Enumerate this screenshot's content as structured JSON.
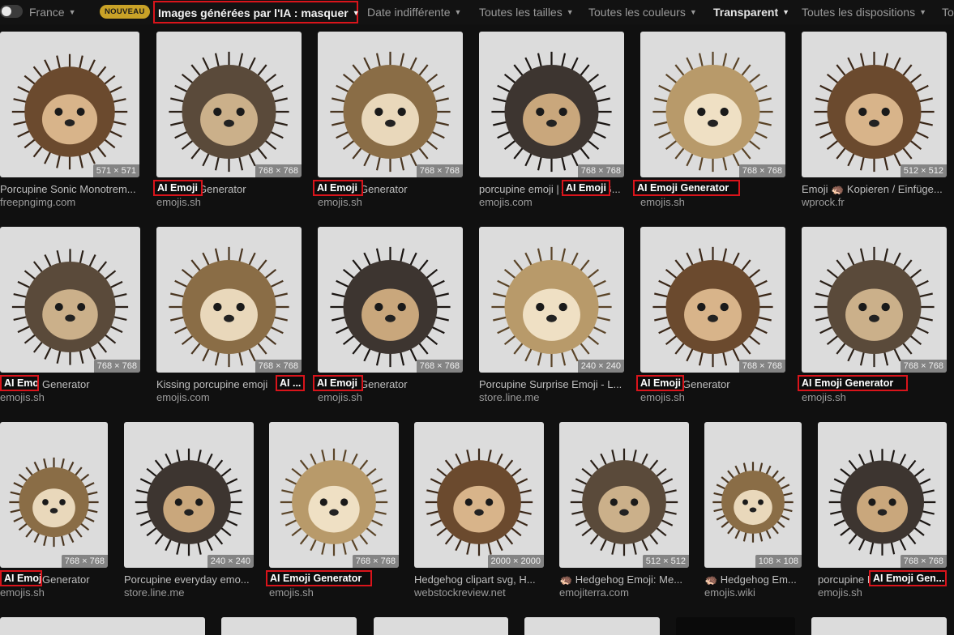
{
  "filters": {
    "region": "France",
    "new_badge": "NOUVEAU",
    "ai_images": "Images générées par l'IA : masquer",
    "date": "Date indifférente",
    "size": "Toutes les tailles",
    "color": "Toutes les couleurs",
    "type": "Transparent",
    "layout": "Toutes les dispositions",
    "overflow": "To"
  },
  "colors": {
    "highlight_border": "#d9141b",
    "new_badge": "#c9a227",
    "background": "#101010"
  },
  "results": [
    {
      "caption": "Porcupine Sonic Monotrem...",
      "source": "freepngimg.com",
      "dims": "571 × 571",
      "highlight": ""
    },
    {
      "caption": "AI Emoji Generator",
      "source": "emojis.sh",
      "dims": "768 × 768",
      "highlight": "AI Emoji"
    },
    {
      "caption": "AI Emoji Generator",
      "source": "emojis.sh",
      "dims": "768 × 768",
      "highlight": "AI Emoji"
    },
    {
      "caption": "porcupine emoji | AI Emoji G...",
      "source": "emojis.com",
      "dims": "768 × 768",
      "highlight": "AI Emoji"
    },
    {
      "caption": "AI Emoji Generator",
      "source": "emojis.sh",
      "dims": "768 × 768",
      "highlight": "AI Emoji Generator"
    },
    {
      "caption": "Emoji 🦔 Kopieren / Einfüge...",
      "source": "wprock.fr",
      "dims": "512 × 512",
      "highlight": ""
    },
    {
      "caption": "AI Emoji Generator",
      "source": "emojis.sh",
      "dims": "768 × 768",
      "highlight": "AI Emoji"
    },
    {
      "caption": "Kissing porcupine emoji",
      "source": "emojis.com",
      "dims": "768 × 768",
      "highlight": "AI ..."
    },
    {
      "caption": "AI Emoji Generator",
      "source": "emojis.sh",
      "dims": "768 × 768",
      "highlight": "AI Emoji"
    },
    {
      "caption": "Porcupine Surprise Emoji - L...",
      "source": "store.line.me",
      "dims": "240 × 240",
      "highlight": ""
    },
    {
      "caption": "AI Emoji Generator",
      "source": "emojis.sh",
      "dims": "768 × 768",
      "highlight": "AI Emoji"
    },
    {
      "caption": "AI Emoji Generator",
      "source": "emojis.sh",
      "dims": "768 × 768",
      "highlight": "AI Emoji Generator"
    },
    {
      "caption": "AI Emoji Generator",
      "source": "emojis.sh",
      "dims": "768 × 768",
      "highlight": "AI Emoji"
    },
    {
      "caption": "Porcupine everyday emo...",
      "source": "store.line.me",
      "dims": "240 × 240",
      "highlight": ""
    },
    {
      "caption": "AI Emoji Generator",
      "source": "emojis.sh",
      "dims": "768 × 768",
      "highlight": "AI Emoji Generator"
    },
    {
      "caption": "Hedgehog clipart svg, H...",
      "source": "webstockreview.net",
      "dims": "2000 × 2000",
      "highlight": ""
    },
    {
      "caption": "🦔 Hedgehog Emoji: Me...",
      "source": "emojiterra.com",
      "dims": "512 × 512",
      "highlight": ""
    },
    {
      "caption": "🦔 Hedgehog Em...",
      "source": "emojis.wiki",
      "dims": "108 × 108",
      "highlight": ""
    },
    {
      "caption": "porcupine I",
      "source": "emojis.sh",
      "dims": "768 × 768",
      "highlight": "AI Emoji Gen..."
    }
  ]
}
